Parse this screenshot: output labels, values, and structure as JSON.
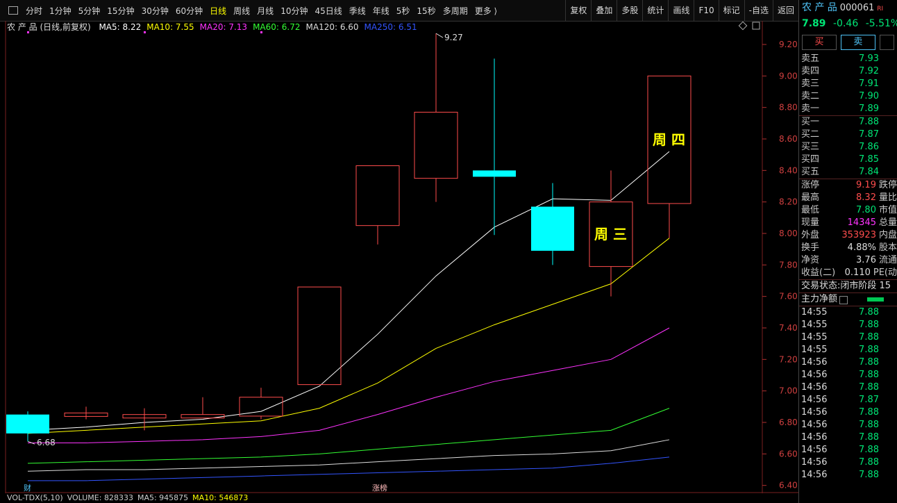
{
  "toolbar": {
    "periods": [
      "分时",
      "1分钟",
      "5分钟",
      "15分钟",
      "30分钟",
      "60分钟",
      "日线",
      "周线",
      "月线",
      "10分钟",
      "45日线",
      "季线",
      "年线",
      "5秒",
      "15秒",
      "多周期",
      "更多 ⟩"
    ],
    "active_period": 6,
    "tools": [
      "复权",
      "叠加",
      "多股",
      "统计",
      "画线",
      "F10",
      "标记",
      "-自选",
      "返回"
    ]
  },
  "legend": {
    "title": "农 产 品 (日线,前复权)",
    "items": [
      {
        "label": "MA5: 8.22",
        "color": "#ffffff"
      },
      {
        "label": "MA10: 7.55",
        "color": "#ffff00"
      },
      {
        "label": "MA20: 7.13",
        "color": "#ff33ff"
      },
      {
        "label": "MA60: 6.72",
        "color": "#33ff33"
      },
      {
        "label": "MA120: 6.60",
        "color": "#dddddd"
      },
      {
        "label": "MA250: 6.51",
        "color": "#3355ff"
      }
    ]
  },
  "annotations": {
    "high_label": "9.27",
    "low_label": "6.68",
    "wed": "周 三",
    "thu": "周 四",
    "cai": "财",
    "zhangbang": "涨榜"
  },
  "vol_legend": {
    "items": [
      {
        "label": "VOL-TDX(5,10)",
        "color": "#cccccc"
      },
      {
        "label": "VOLUME: 828333",
        "color": "#cccccc"
      },
      {
        "label": "MA5: 945875",
        "color": "#cccccc"
      },
      {
        "label": "MA10: 546873",
        "color": "#ffff00"
      }
    ]
  },
  "chart_data": {
    "type": "candlestick",
    "y_axis_ticks": [
      9.2,
      9.0,
      8.8,
      8.6,
      8.4,
      8.2,
      8.0,
      7.8,
      7.6,
      7.4,
      7.2,
      7.0,
      6.8,
      6.6,
      6.4
    ],
    "ylim": [
      6.35,
      9.35
    ],
    "candles": [
      {
        "open": 6.85,
        "close": 6.73,
        "high": 6.87,
        "low": 6.68
      },
      {
        "open": 6.86,
        "close": 6.86,
        "high": 6.9,
        "low": 6.82
      },
      {
        "open": 6.85,
        "close": 6.85,
        "high": 6.89,
        "low": 6.75
      },
      {
        "open": 6.84,
        "close": 6.85,
        "high": 6.96,
        "low": 6.84
      },
      {
        "open": 6.84,
        "close": 6.96,
        "high": 7.02,
        "low": 6.82
      },
      {
        "open": 7.04,
        "close": 7.66,
        "high": 7.66,
        "low": 7.04
      },
      {
        "open": 8.05,
        "close": 8.43,
        "high": 8.43,
        "low": 7.93
      },
      {
        "open": 8.35,
        "close": 8.77,
        "high": 9.27,
        "low": 8.2
      },
      {
        "open": 8.4,
        "close": 8.36,
        "high": 9.11,
        "low": 7.99
      },
      {
        "open": 8.17,
        "close": 7.89,
        "high": 8.32,
        "low": 7.8
      },
      {
        "open": 7.79,
        "close": 8.2,
        "high": 8.4,
        "low": 7.6
      },
      {
        "open": 8.19,
        "close": 9.0,
        "high": 9.0,
        "low": 7.97
      }
    ],
    "series": [
      {
        "name": "MA5",
        "color": "#ffffff",
        "values": [
          6.75,
          6.77,
          6.8,
          6.82,
          6.87,
          7.03,
          7.36,
          7.73,
          8.04,
          8.22,
          8.21,
          8.52
        ]
      },
      {
        "name": "MA10",
        "color": "#ffff00",
        "values": [
          6.73,
          6.75,
          6.77,
          6.79,
          6.81,
          6.89,
          7.05,
          7.27,
          7.42,
          7.55,
          7.68,
          7.97
        ]
      },
      {
        "name": "MA20",
        "color": "#ff33ff",
        "values": [
          6.67,
          6.67,
          6.68,
          6.69,
          6.71,
          6.75,
          6.85,
          6.96,
          7.06,
          7.13,
          7.2,
          7.4
        ]
      },
      {
        "name": "MA60",
        "color": "#33ff33",
        "values": [
          6.54,
          6.55,
          6.56,
          6.57,
          6.58,
          6.6,
          6.63,
          6.66,
          6.69,
          6.72,
          6.75,
          6.89
        ]
      },
      {
        "name": "MA120",
        "color": "#dddddd",
        "values": [
          6.49,
          6.5,
          6.5,
          6.51,
          6.52,
          6.53,
          6.55,
          6.57,
          6.59,
          6.6,
          6.62,
          6.69
        ]
      },
      {
        "name": "MA250",
        "color": "#3355ff",
        "values": [
          6.43,
          6.43,
          6.44,
          6.45,
          6.46,
          6.47,
          6.48,
          6.49,
          6.5,
          6.51,
          6.54,
          6.58
        ]
      }
    ],
    "up_color": "#ff4d4d",
    "down_color": "#00ffff"
  },
  "quote": {
    "name": "农 产 品",
    "code": "000061",
    "badge": "RI",
    "price": "7.89",
    "change": "-0.46",
    "pct": "-5.51%",
    "buy_label": "买",
    "sell_label": "卖"
  },
  "orderbook": {
    "asks": [
      {
        "k": "卖五",
        "v": "7.93"
      },
      {
        "k": "卖四",
        "v": "7.92"
      },
      {
        "k": "卖三",
        "v": "7.91"
      },
      {
        "k": "卖二",
        "v": "7.90"
      },
      {
        "k": "卖一",
        "v": "7.89"
      }
    ],
    "bids": [
      {
        "k": "买一",
        "v": "7.88"
      },
      {
        "k": "买二",
        "v": "7.87"
      },
      {
        "k": "买三",
        "v": "7.86"
      },
      {
        "k": "买四",
        "v": "7.85"
      },
      {
        "k": "买五",
        "v": "7.84"
      }
    ]
  },
  "stats": [
    {
      "k": "涨停",
      "v": "9.19",
      "vc": "#ff4d4d",
      "k2": "跌停"
    },
    {
      "k": "最高",
      "v": "8.32",
      "vc": "#ff4d4d",
      "k2": "量比"
    },
    {
      "k": "最低",
      "v": "7.80",
      "vc": "#00e676",
      "k2": "市值"
    },
    {
      "k": "现量",
      "v": "14345",
      "vc": "#ff33ff",
      "k2": "总量"
    },
    {
      "k": "外盘",
      "v": "353923",
      "vc": "#ff4d4d",
      "k2": "内盘"
    },
    {
      "k": "换手",
      "v": "4.88%",
      "vc": "#dddddd",
      "k2": "股本"
    },
    {
      "k": "净资",
      "v": "3.76",
      "vc": "#dddddd",
      "k2": "流通"
    },
    {
      "k": "收益(二)",
      "v": "0.110",
      "vc": "#dddddd",
      "k2": "PE(动"
    }
  ],
  "trade_status": {
    "label": "交易状态:",
    "value": "闭市阶段 15"
  },
  "main_flow": {
    "label": "主力净额"
  },
  "ticks": [
    {
      "t": "14:55",
      "p": "7.88"
    },
    {
      "t": "14:55",
      "p": "7.88"
    },
    {
      "t": "14:55",
      "p": "7.88"
    },
    {
      "t": "14:55",
      "p": "7.88"
    },
    {
      "t": "14:56",
      "p": "7.88"
    },
    {
      "t": "14:56",
      "p": "7.88"
    },
    {
      "t": "14:56",
      "p": "7.88"
    },
    {
      "t": "14:56",
      "p": "7.87"
    },
    {
      "t": "14:56",
      "p": "7.88"
    },
    {
      "t": "14:56",
      "p": "7.88"
    },
    {
      "t": "14:56",
      "p": "7.88"
    },
    {
      "t": "14:56",
      "p": "7.88"
    },
    {
      "t": "14:56",
      "p": "7.88"
    },
    {
      "t": "14:56",
      "p": "7.88"
    }
  ]
}
